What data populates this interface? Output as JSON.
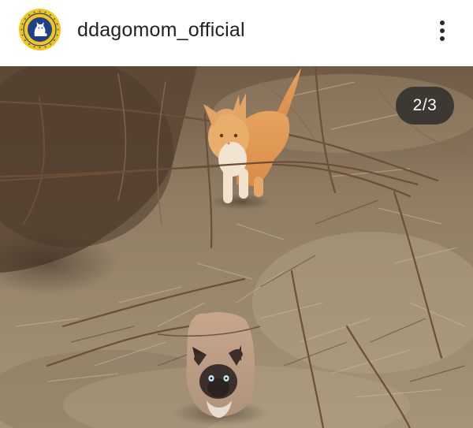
{
  "post": {
    "username": "ddagomom_official",
    "avatar_icon": "association-logo-cat-icon",
    "more_icon": "more-vertical-icon",
    "image_description_icon": "cats-photo",
    "page_indicator": "2/3"
  },
  "colors": {
    "avatar_ring": "#f3c51b",
    "avatar_inner": "#1d3f8c",
    "indicator_bg": "#262626"
  }
}
